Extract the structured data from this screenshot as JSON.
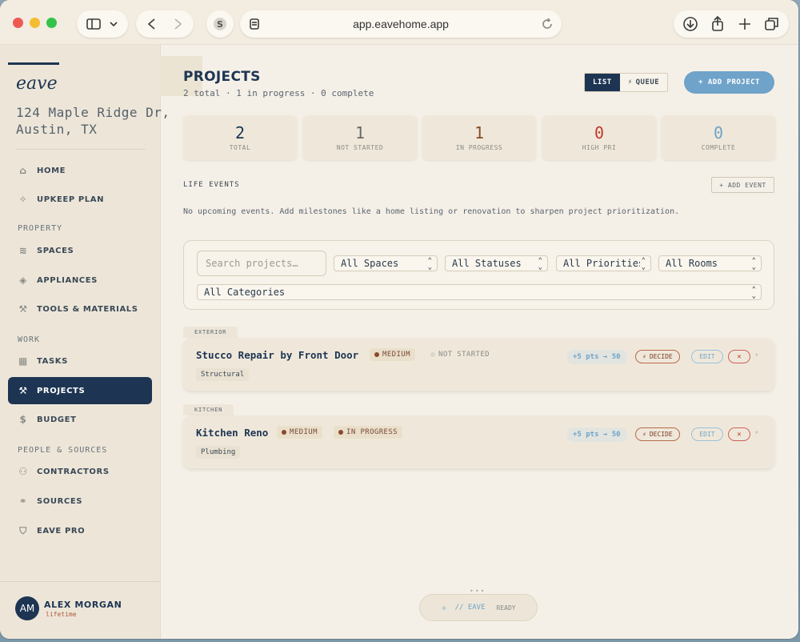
{
  "browser": {
    "url": "app.eavehome.app"
  },
  "sidebar": {
    "logo": "eave",
    "address": "124 Maple Ridge Dr,\nAustin, TX",
    "items": [
      {
        "label": "HOME",
        "icon": "home-icon"
      },
      {
        "label": "UPKEEP PLAN",
        "icon": "sparkle-icon"
      },
      {
        "label": "SPACES",
        "icon": "layers-icon"
      },
      {
        "label": "APPLIANCES",
        "icon": "box-icon"
      },
      {
        "label": "TOOLS & MATERIALS",
        "icon": "wrench-icon"
      },
      {
        "label": "TASKS",
        "icon": "calendar-icon"
      },
      {
        "label": "PROJECTS",
        "icon": "hammer-icon"
      },
      {
        "label": "BUDGET",
        "icon": "dollar-icon"
      },
      {
        "label": "CONTRACTORS",
        "icon": "people-icon"
      },
      {
        "label": "SOURCES",
        "icon": "link-icon"
      },
      {
        "label": "EAVE PRO",
        "icon": "shield-icon"
      }
    ],
    "sections": {
      "property": "PROPERTY",
      "work": "WORK",
      "people": "PEOPLE & SOURCES"
    },
    "user": {
      "initials": "AM",
      "name": "ALEX MORGAN",
      "plan": "lifetime"
    }
  },
  "main": {
    "title": "PROJECTS",
    "subtitle": "2 total · 1 in progress · 0 complete",
    "view_list": "LIST",
    "view_queue": "QUEUE",
    "add_project": "+ ADD PROJECT",
    "stats": [
      {
        "value": "2",
        "label": "TOTAL",
        "color": "#1d3553"
      },
      {
        "value": "1",
        "label": "NOT STARTED",
        "color": "#6a6a66"
      },
      {
        "value": "1",
        "label": "IN PROGRESS",
        "color": "#8a4a2a"
      },
      {
        "value": "0",
        "label": "HIGH PRI",
        "color": "#c0392b"
      },
      {
        "value": "0",
        "label": "COMPLETE",
        "color": "#6fa3c9"
      }
    ],
    "life_events": {
      "label": "LIFE EVENTS",
      "add_label": "+ ADD EVENT",
      "message": "No upcoming events. Add milestones like a home listing or renovation to sharpen project prioritization."
    },
    "filters": {
      "search_placeholder": "Search projects…",
      "spaces": "All Spaces",
      "statuses": "All Statuses",
      "priorities": "All Priorities",
      "rooms": "All Rooms",
      "categories": "All Categories"
    },
    "groups": [
      {
        "name": "EXTERIOR",
        "project": {
          "title": "Stucco Repair by Front Door",
          "priority": "MEDIUM",
          "status": "NOT STARTED",
          "category": "Structural",
          "points": "+5 pts → 50",
          "decide": "DECIDE",
          "edit": "EDIT",
          "delete": "✕"
        }
      },
      {
        "name": "KITCHEN",
        "project": {
          "title": "Kitchen Reno",
          "priority": "MEDIUM",
          "status": "IN PROGRESS",
          "category": "Plumbing",
          "points": "+5 pts → 50",
          "decide": "DECIDE",
          "edit": "EDIT",
          "delete": "✕"
        }
      }
    ],
    "assistant": {
      "label": "// EAVE",
      "status": "READY"
    }
  }
}
